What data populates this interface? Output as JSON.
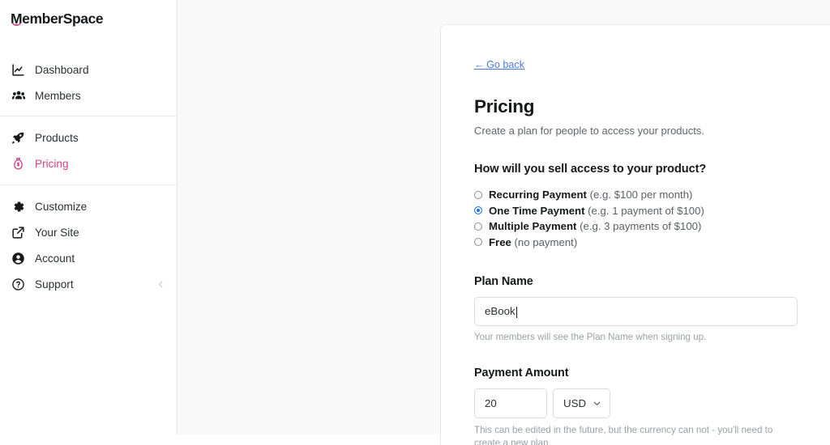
{
  "brand": {
    "logo_text": "MemberSpace",
    "accent_color": "#d43f87",
    "link_color": "#4a7ddd",
    "radio_selected_color": "#1a73e8"
  },
  "sidebar": {
    "groups": [
      {
        "items": [
          {
            "label": "Dashboard",
            "icon": "chart-line-icon",
            "active": false
          },
          {
            "label": "Members",
            "icon": "users-icon",
            "active": false
          }
        ]
      },
      {
        "items": [
          {
            "label": "Products",
            "icon": "rocket-icon",
            "active": false
          },
          {
            "label": "Pricing",
            "icon": "money-bag-icon",
            "active": true
          }
        ]
      },
      {
        "items": [
          {
            "label": "Customize",
            "icon": "gear-icon",
            "active": false
          },
          {
            "label": "Your Site",
            "icon": "external-link-icon",
            "active": false
          },
          {
            "label": "Account",
            "icon": "user-circle-icon",
            "active": false
          },
          {
            "label": "Support",
            "icon": "question-circle-icon",
            "active": false,
            "trailing_icon": "chevron-left-icon"
          }
        ]
      }
    ]
  },
  "main": {
    "go_back": "Go back",
    "go_back_arrow": "←",
    "title": "Pricing",
    "subtitle": "Create a plan for people to access your products.",
    "question": "How will you sell access to your product?",
    "payment_options": [
      {
        "name": "Recurring Payment",
        "example": " (e.g. $100 per month)",
        "selected": false
      },
      {
        "name": "One Time Payment",
        "example": " (e.g. 1 payment of $100)",
        "selected": true
      },
      {
        "name": "Multiple Payment",
        "example": " (e.g. 3 payments of $100)",
        "selected": false
      },
      {
        "name": "Free",
        "example": " (no payment)",
        "selected": false
      }
    ],
    "plan_name": {
      "label": "Plan Name",
      "value": "eBook",
      "placeholder": "",
      "help": "Your members will see the Plan Name when signing up."
    },
    "payment_amount": {
      "label": "Payment Amount",
      "value": "20",
      "placeholder": "",
      "currency": "USD",
      "currency_options": [
        "USD"
      ],
      "help": "This can be edited in the future, but the currency can not - you'll need to create a new plan."
    }
  }
}
